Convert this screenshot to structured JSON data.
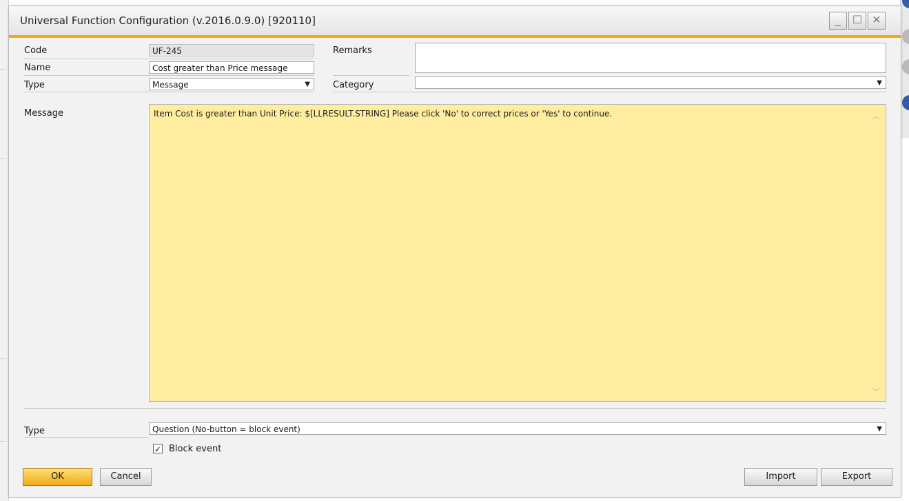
{
  "window": {
    "title": "Universal Function Configuration (v.2016.0.9.0) [920110]"
  },
  "form": {
    "code_label": "Code",
    "code_value": "UF-245",
    "name_label": "Name",
    "name_value": "Cost greater than Price message",
    "type_label": "Type",
    "type_value": "Message",
    "remarks_label": "Remarks",
    "remarks_value": "",
    "category_label": "Category",
    "category_value": "",
    "message_label": "Message",
    "message_text": "Item Cost is greater than Unit Price: $[LLRESULT.STRING]  Please click 'No' to correct prices or 'Yes' to continue.",
    "message_type_label": "Type",
    "message_type_value": "Question (No-button = block event)",
    "block_event_label": "Block event",
    "block_event_checked": true
  },
  "buttons": {
    "ok": "OK",
    "cancel": "Cancel",
    "import": "Import",
    "export": "Export"
  },
  "colors": {
    "accent": "#f0ab10",
    "message_bg": "#ffeea0"
  }
}
